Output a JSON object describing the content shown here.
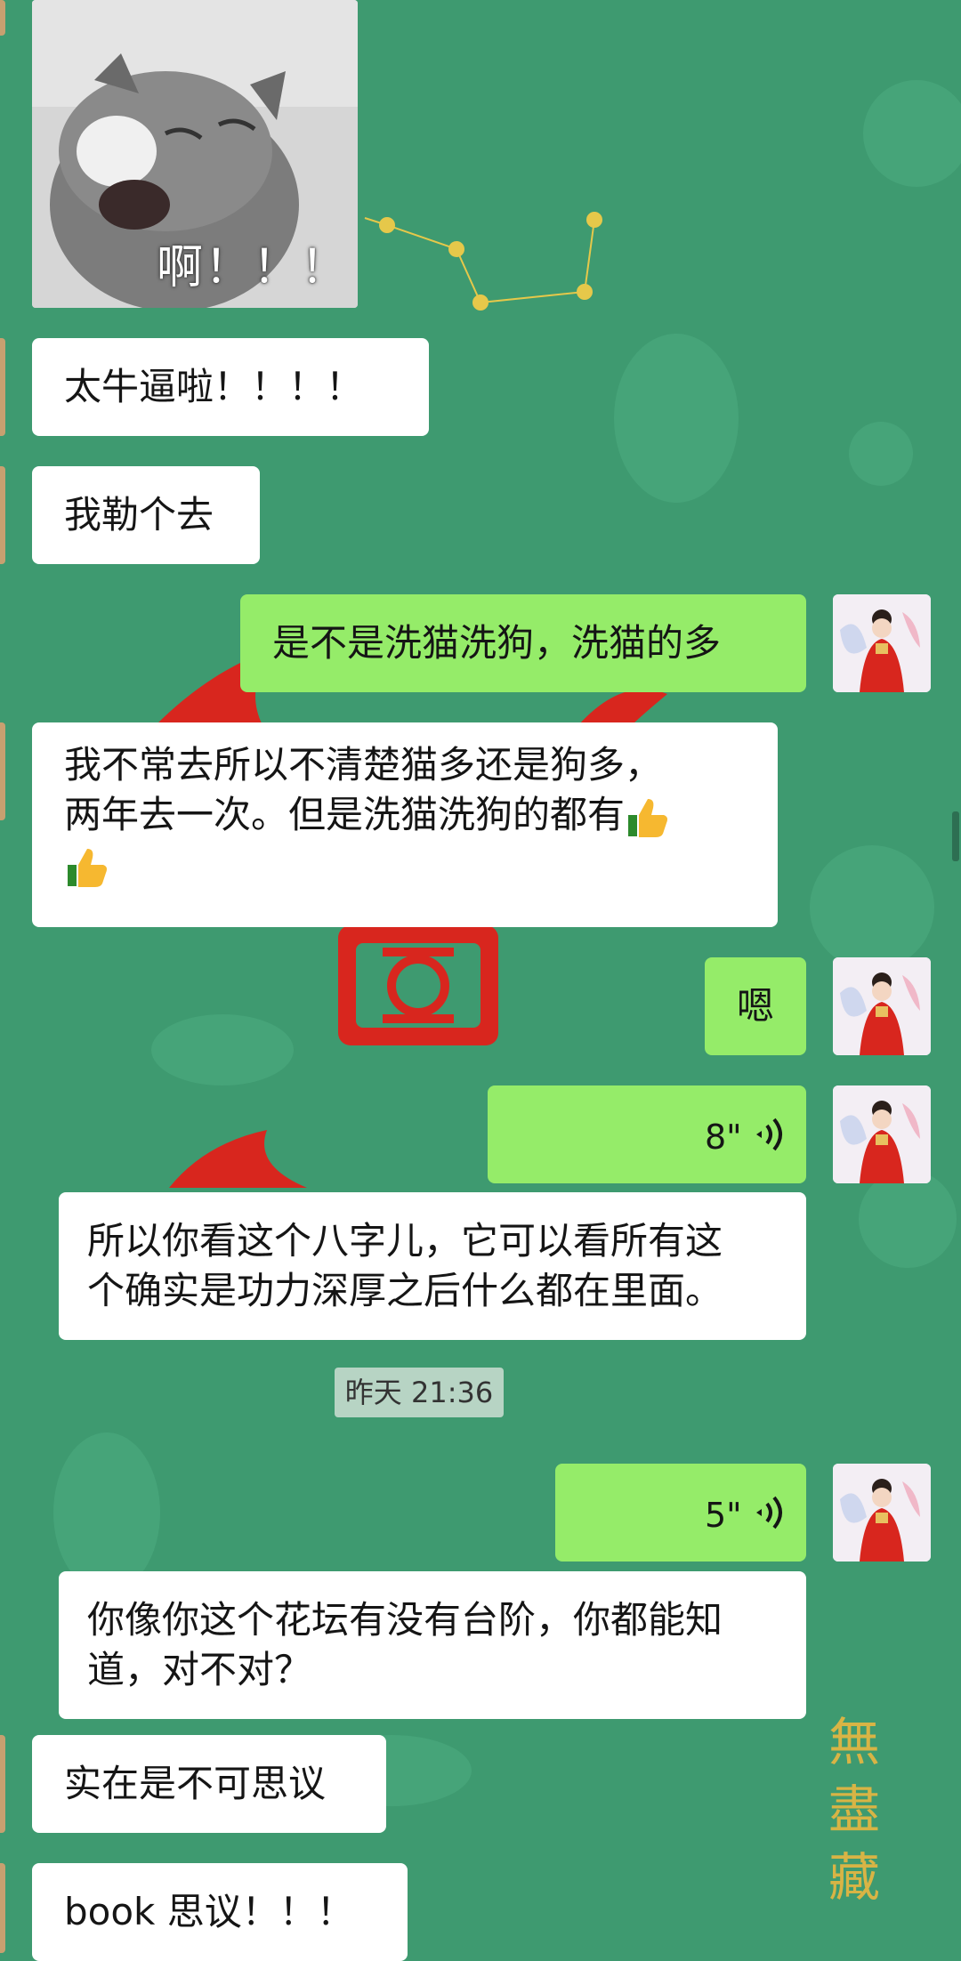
{
  "sticker": {
    "caption": "啊！！！"
  },
  "timestamp": "昨天 21:36",
  "watermark": "無盡藏",
  "messages": [
    {
      "text": "太牛逼啦！！！！"
    },
    {
      "text": "我勒个去"
    },
    {
      "text": "是不是洗猫洗狗，洗猫的多"
    },
    {
      "text_line1": "我不常去所以不清楚猫多还是狗多，",
      "text_line2": "两年去一次。但是洗猫洗狗的都有"
    },
    {
      "text": "嗯"
    },
    {
      "duration": "8\""
    },
    {
      "text_line1": "所以你看这个八字儿，它可以看所有这",
      "text_line2": "个确实是功力深厚之后什么都在里面。"
    },
    {
      "duration": "5\""
    },
    {
      "text_line1": "你像你这个花坛有没有台阶，你都能知",
      "text_line2": "道，对不对？"
    },
    {
      "text": "实在是不可思议"
    },
    {
      "text": "book 思议！！！"
    }
  ],
  "icons": {
    "thumbs_up": "thumbs-up-emoji",
    "voice": "voice-wave-icon",
    "avatar": "avatar-girl-red-hanfu"
  },
  "colors": {
    "background": "#3e9a70",
    "bubble_in": "#ffffff",
    "bubble_out": "#95ec69",
    "accent_red": "#d8261e",
    "accent_gold": "#d8b445"
  }
}
